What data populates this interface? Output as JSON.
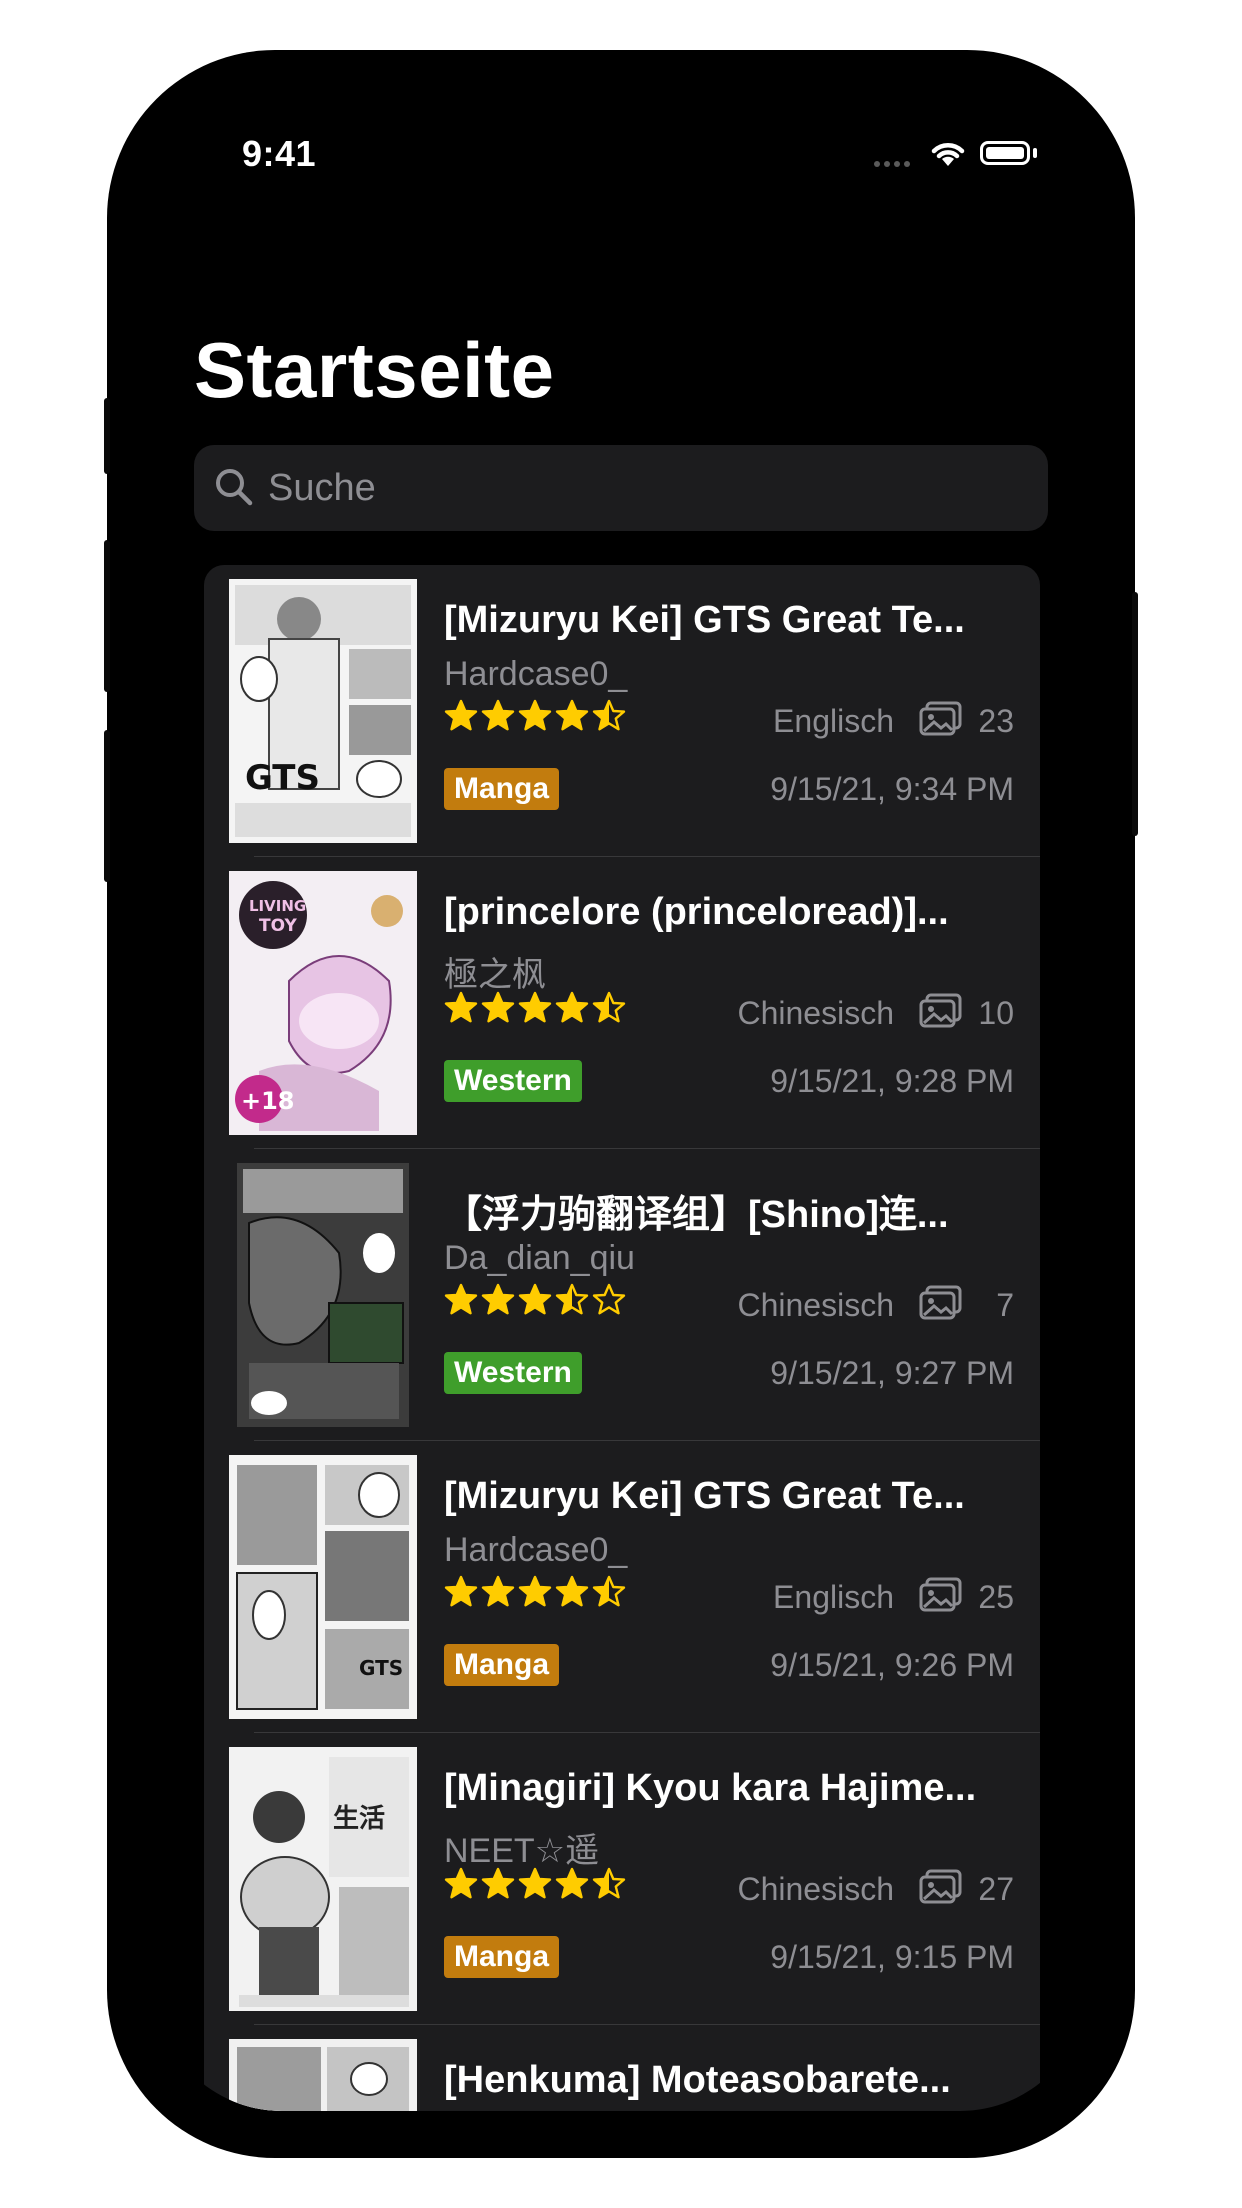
{
  "status_bar": {
    "time": "9:41"
  },
  "header": {
    "title": "Startseite"
  },
  "search": {
    "placeholder": "Suche",
    "value": ""
  },
  "colors": {
    "background": "#000000",
    "card": "#1c1c1e",
    "secondary_text": "#8e8e93",
    "star": "#ffcc00",
    "category_manga": "#c27c0e",
    "category_western": "#3f9e2b"
  },
  "list": {
    "items": [
      {
        "title": "[Mizuryu Kei] GTS Great Te...",
        "uploader": "Hardcase0_",
        "rating": 4.5,
        "language": "Englisch",
        "pages": "23",
        "category": "Manga",
        "category_color": "#c27c0e",
        "date": "9/15/21, 9:34 PM"
      },
      {
        "title": "[princelore (princeloread)]...",
        "uploader": "極之枫",
        "rating": 4.5,
        "language": "Chinesisch",
        "pages": "10",
        "category": "Western",
        "category_color": "#3f9e2b",
        "date": "9/15/21, 9:28 PM"
      },
      {
        "title": "【浮力驹翻译组】[Shino]连...",
        "uploader": "Da_dian_qiu",
        "rating": 3.5,
        "language": "Chinesisch",
        "pages": "7",
        "category": "Western",
        "category_color": "#3f9e2b",
        "date": "9/15/21, 9:27 PM"
      },
      {
        "title": "[Mizuryu Kei] GTS Great Te...",
        "uploader": "Hardcase0_",
        "rating": 4.5,
        "language": "Englisch",
        "pages": "25",
        "category": "Manga",
        "category_color": "#c27c0e",
        "date": "9/15/21, 9:26 PM"
      },
      {
        "title": "[Minagiri] Kyou kara Hajime...",
        "uploader": "NEET☆遥",
        "rating": 4.5,
        "language": "Chinesisch",
        "pages": "27",
        "category": "Manga",
        "category_color": "#c27c0e",
        "date": "9/15/21, 9:15 PM"
      },
      {
        "title": "[Henkuma] Moteasobarete...",
        "uploader": "",
        "rating": null,
        "language": "",
        "pages": "",
        "category": "",
        "category_color": "",
        "date": ""
      }
    ]
  }
}
